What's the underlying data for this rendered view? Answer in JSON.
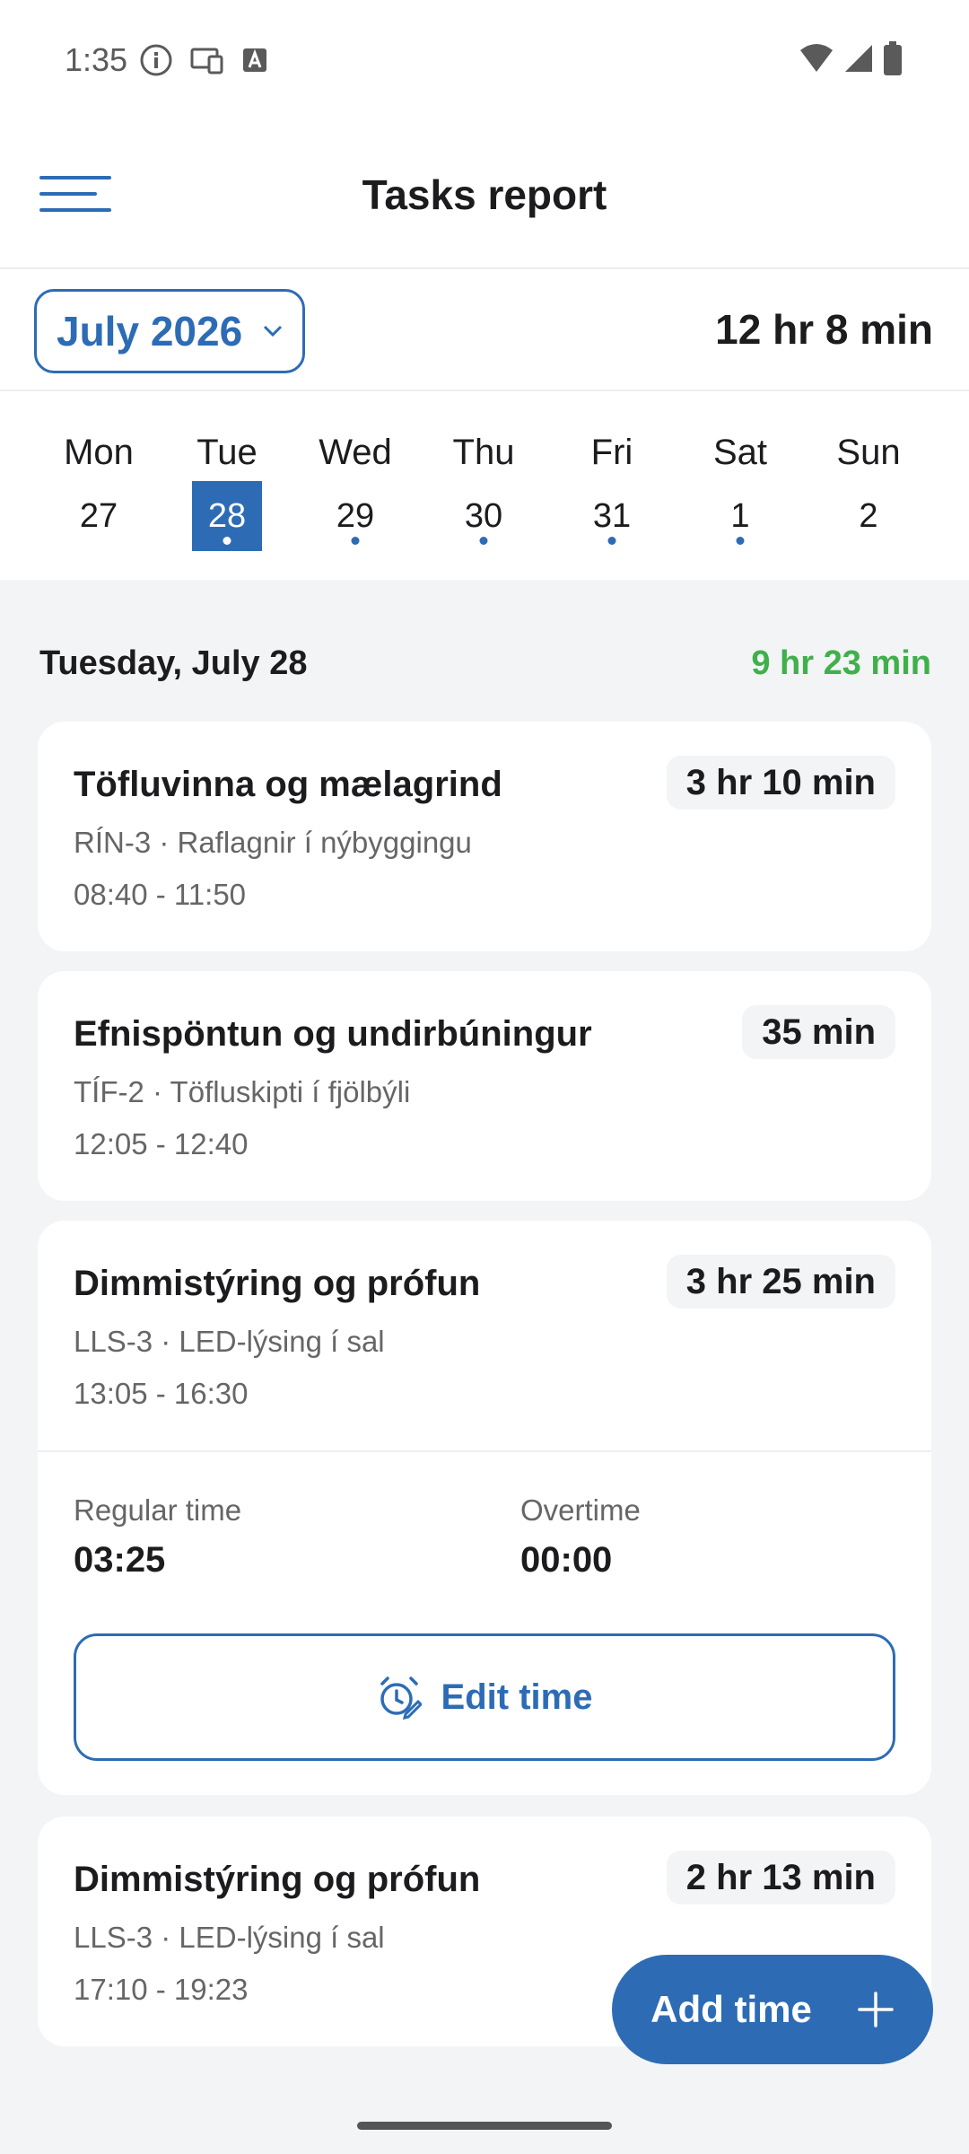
{
  "status_bar": {
    "time": "1:35",
    "icons_left": [
      "info-icon",
      "cast-icon",
      "keyboard-a-icon"
    ],
    "icons_right": [
      "wifi-icon",
      "signal-icon",
      "battery-icon"
    ]
  },
  "app_bar": {
    "title": "Tasks report",
    "menu_icon": "menu-icon"
  },
  "month": {
    "label": "July 2026",
    "total": "12 hr 8 min"
  },
  "week": [
    {
      "name": "Mon",
      "num": "27",
      "selected": false,
      "dot": false
    },
    {
      "name": "Tue",
      "num": "28",
      "selected": true,
      "dot": true
    },
    {
      "name": "Wed",
      "num": "29",
      "selected": false,
      "dot": true
    },
    {
      "name": "Thu",
      "num": "30",
      "selected": false,
      "dot": true
    },
    {
      "name": "Fri",
      "num": "31",
      "selected": false,
      "dot": true
    },
    {
      "name": "Sat",
      "num": "1",
      "selected": false,
      "dot": true
    },
    {
      "name": "Sun",
      "num": "2",
      "selected": false,
      "dot": false
    }
  ],
  "day": {
    "title": "Tuesday, July 28",
    "total": "9 hr 23 min"
  },
  "tasks": [
    {
      "title": "Töfluvinna og mælagrind",
      "duration": "3 hr 10 min",
      "sub": "RÍN-3 · Raflagnir í nýbyggingu",
      "time": "08:40 - 11:50"
    },
    {
      "title": "Efnispöntun og undirbúningur",
      "duration": "35 min",
      "sub": "TÍF-2 · Töfluskipti í fjölbýli",
      "time": "12:05 - 12:40"
    },
    {
      "title": "Dimmistýring og prófun",
      "duration": "3 hr 25 min",
      "sub": "LLS-3 · LED-lýsing í sal",
      "time": "13:05 - 16:30",
      "regular_label": "Regular time",
      "regular_value": "03:25",
      "overtime_label": "Overtime",
      "overtime_value": "00:00",
      "edit_label": "Edit time"
    },
    {
      "title": "Dimmistýring og prófun",
      "duration": "2 hr 13 min",
      "sub": "LLS-3 · LED-lýsing í sal",
      "time": "17:10 - 19:23"
    }
  ],
  "fab": {
    "label": "Add time"
  },
  "colors": {
    "accent": "#2d6cb5",
    "success": "#3fb04a",
    "background": "#f3f4f6"
  }
}
